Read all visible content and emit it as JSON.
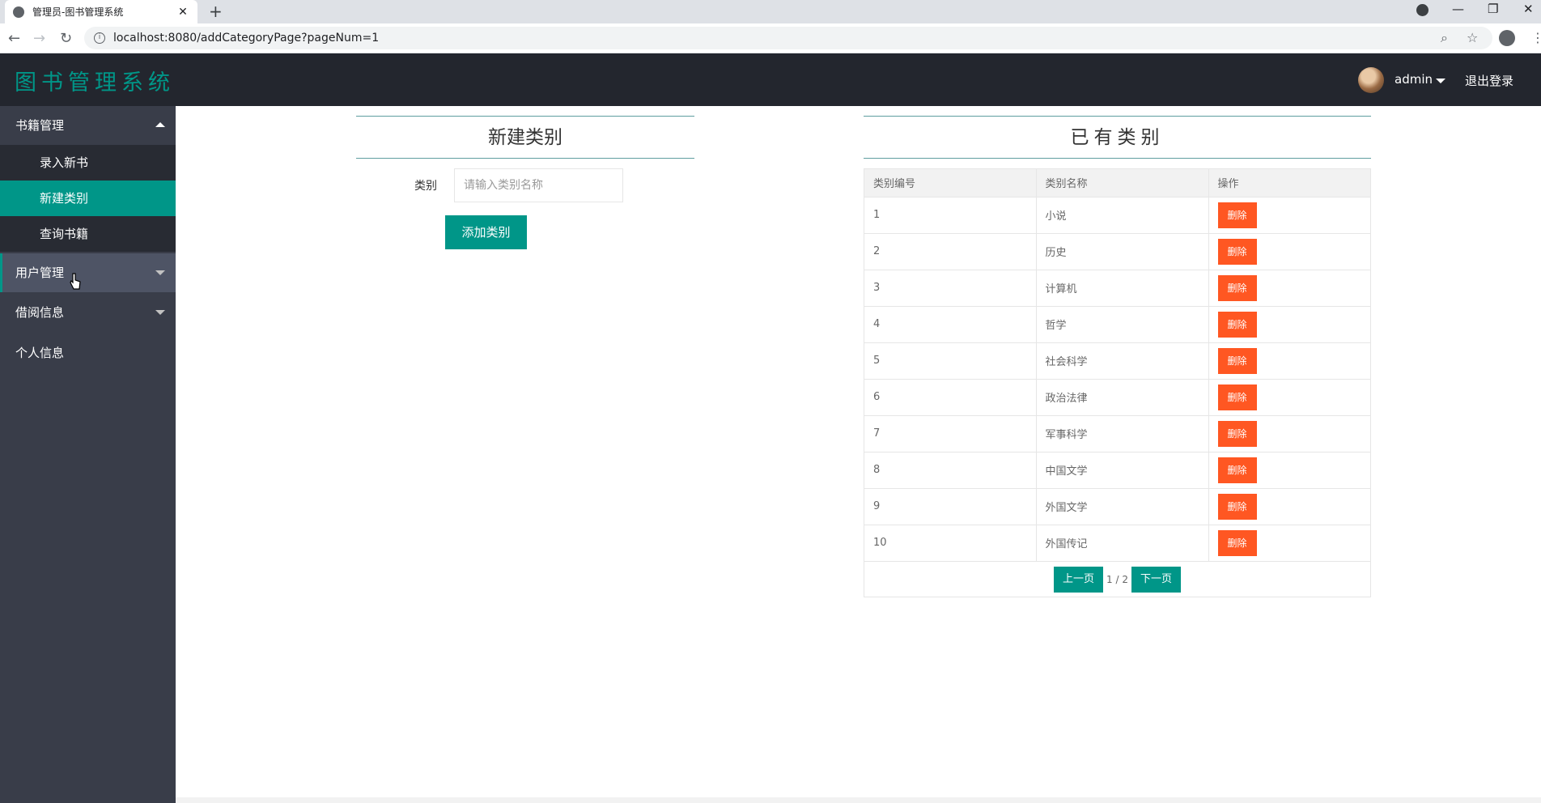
{
  "browser": {
    "tab_title": "管理员-图书管理系统",
    "url": "localhost:8080/addCategoryPage?pageNum=1"
  },
  "header": {
    "logo": "图书管理系统",
    "username": "admin",
    "logout": "退出登录"
  },
  "sidebar": {
    "groups": [
      {
        "label": "书籍管理",
        "expanded": true,
        "items": [
          "录入新书",
          "新建类别",
          "查询书籍"
        ]
      },
      {
        "label": "用户管理"
      },
      {
        "label": "借阅信息"
      },
      {
        "label": "个人信息"
      }
    ],
    "active_item": "新建类别"
  },
  "form": {
    "title": "新建类别",
    "field_label": "类别",
    "placeholder": "请输入类别名称",
    "submit": "添加类别"
  },
  "category_table": {
    "title": "已有类别",
    "columns": [
      "类别编号",
      "类别名称",
      "操作"
    ],
    "rows": [
      {
        "id": "1",
        "name": "小说"
      },
      {
        "id": "2",
        "name": "历史"
      },
      {
        "id": "3",
        "name": "计算机"
      },
      {
        "id": "4",
        "name": "哲学"
      },
      {
        "id": "5",
        "name": "社会科学"
      },
      {
        "id": "6",
        "name": "政治法律"
      },
      {
        "id": "7",
        "name": "军事科学"
      },
      {
        "id": "8",
        "name": "中国文学"
      },
      {
        "id": "9",
        "name": "外国文学"
      },
      {
        "id": "10",
        "name": "外国传记"
      }
    ],
    "delete_label": "删除",
    "pagination": {
      "prev": "上一页",
      "info": "1 / 2",
      "next": "下一页"
    }
  },
  "colors": {
    "accent": "#009688",
    "danger": "#ff5722",
    "header_bg": "#23262e",
    "sidebar_bg": "#393d49"
  }
}
